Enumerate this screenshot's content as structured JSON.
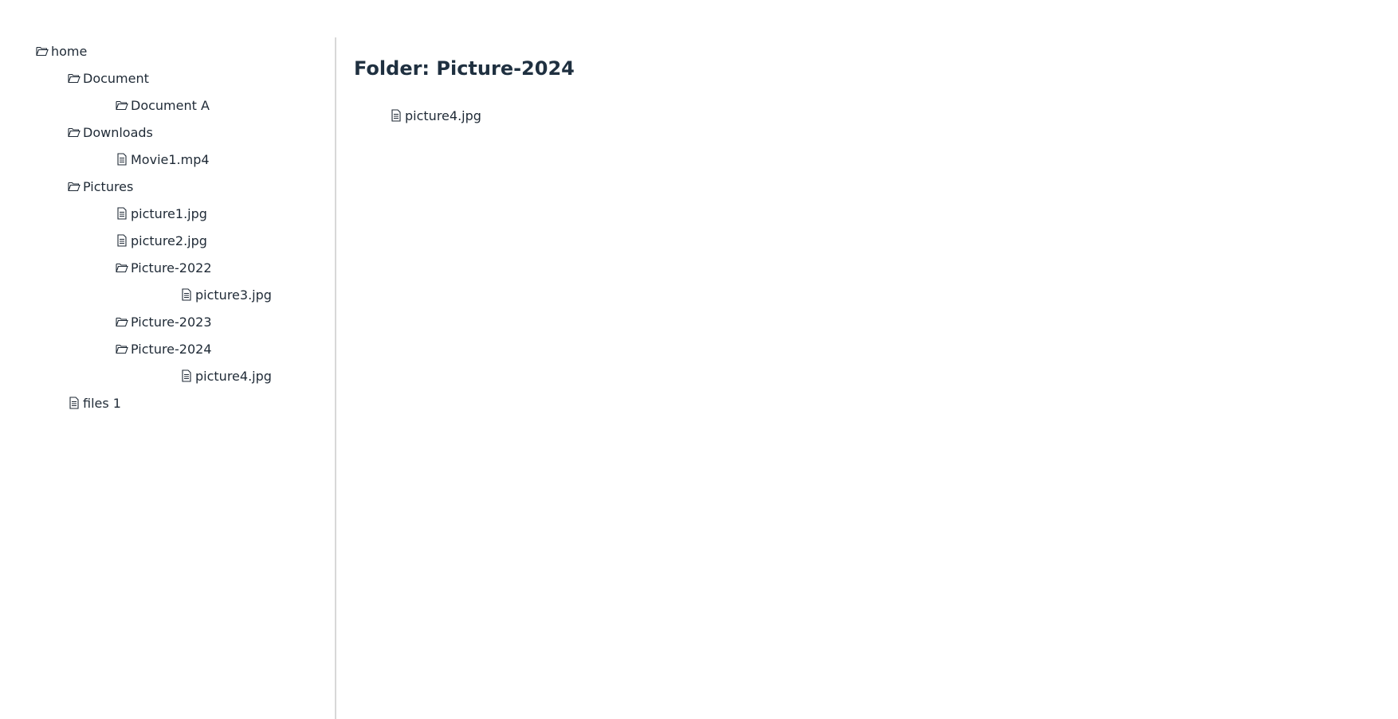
{
  "sidebar": {
    "tree": [
      {
        "label": "home",
        "type": "folder",
        "icon": "folder-open-icon"
      },
      {
        "label": "Document",
        "type": "folder",
        "icon": "folder-open-icon"
      },
      {
        "label": "Document A",
        "type": "folder",
        "icon": "folder-open-icon"
      },
      {
        "label": "Downloads",
        "type": "folder",
        "icon": "folder-open-icon"
      },
      {
        "label": "Movie1.mp4",
        "type": "file",
        "icon": "file-icon"
      },
      {
        "label": "Pictures",
        "type": "folder",
        "icon": "folder-open-icon"
      },
      {
        "label": "picture1.jpg",
        "type": "file",
        "icon": "file-icon"
      },
      {
        "label": "picture2.jpg",
        "type": "file",
        "icon": "file-icon"
      },
      {
        "label": "Picture-2022",
        "type": "folder",
        "icon": "folder-open-icon"
      },
      {
        "label": "picture3.jpg",
        "type": "file",
        "icon": "file-icon"
      },
      {
        "label": "Picture-2023",
        "type": "folder",
        "icon": "folder-open-icon"
      },
      {
        "label": "Picture-2024",
        "type": "folder",
        "icon": "folder-open-icon"
      },
      {
        "label": "picture4.jpg",
        "type": "file",
        "icon": "file-icon"
      },
      {
        "label": "files 1",
        "type": "file",
        "icon": "file-icon"
      }
    ]
  },
  "main": {
    "title": "Folder: Picture-2024",
    "items": [
      {
        "label": "picture4.jpg",
        "type": "file",
        "icon": "file-icon"
      }
    ]
  },
  "colors": {
    "text": "#1f2a36",
    "title": "#1f3040",
    "divider": "#d8d8d8"
  }
}
